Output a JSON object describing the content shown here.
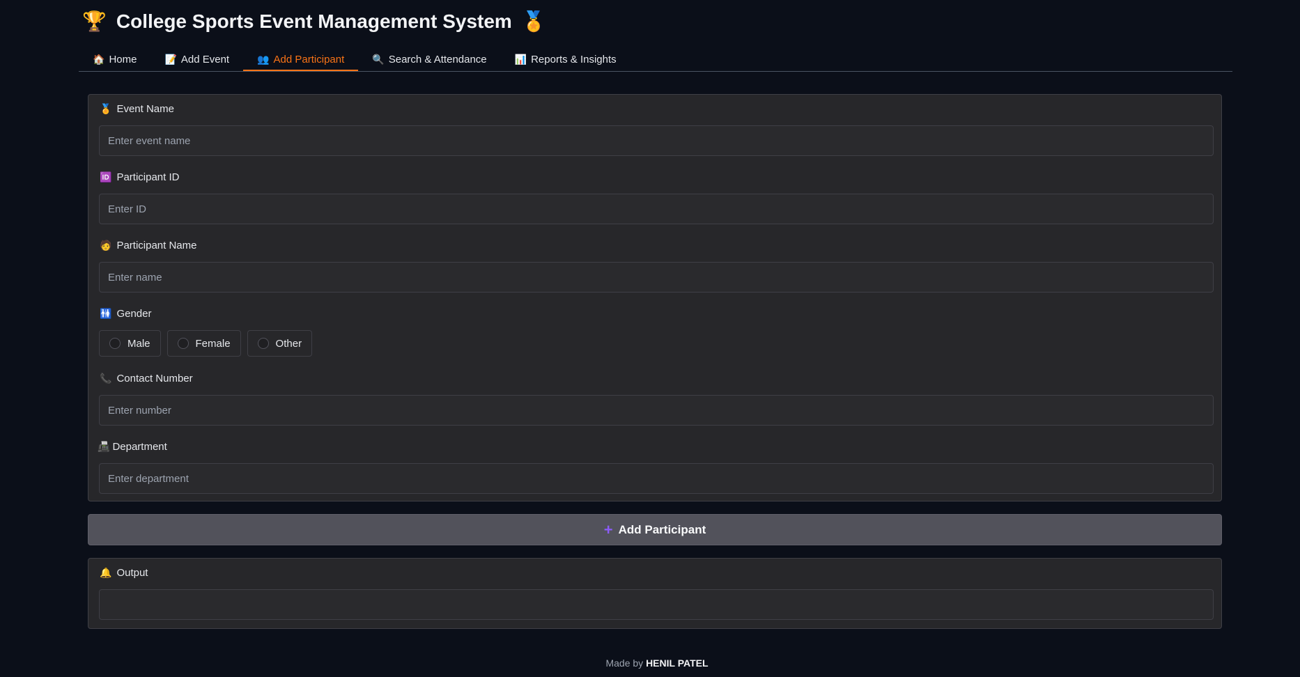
{
  "header": {
    "title": "College Sports Event Management System",
    "left_emoji": "🏆",
    "right_emoji": "🏅"
  },
  "tabs": [
    {
      "icon": "🏠",
      "label": "Home",
      "active": false
    },
    {
      "icon": "📝",
      "label": "Add Event",
      "active": false
    },
    {
      "icon": "👥",
      "label": "Add Participant",
      "active": true
    },
    {
      "icon": "🔍",
      "label": "Search & Attendance",
      "active": false
    },
    {
      "icon": "📊",
      "label": "Reports & Insights",
      "active": false
    }
  ],
  "form": {
    "event_name": {
      "icon": "🏅",
      "label": "Event Name",
      "placeholder": "Enter event name",
      "value": ""
    },
    "participant_id": {
      "icon": "🆔",
      "label": "Participant ID",
      "placeholder": "Enter ID",
      "value": ""
    },
    "participant_name": {
      "icon": "🧑",
      "label": "Participant Name",
      "placeholder": "Enter name",
      "value": ""
    },
    "gender": {
      "icon": "🚻",
      "label": "Gender",
      "options": [
        "Male",
        "Female",
        "Other"
      ],
      "selected": null
    },
    "contact": {
      "icon": "📞",
      "label": "Contact Number",
      "placeholder": "Enter number",
      "value": ""
    },
    "department": {
      "icon": "📠",
      "label": "Department",
      "placeholder": "Enter department",
      "value": ""
    }
  },
  "submit": {
    "icon": "➕",
    "label": "Add Participant"
  },
  "output": {
    "icon": "🔔",
    "label": "Output",
    "value": ""
  },
  "footer": {
    "prefix": "Made by",
    "author": "HENIL PATEL"
  },
  "colors": {
    "accent": "#f97316",
    "background": "#0b0f19",
    "panel": "#27272a",
    "button": "#52525b"
  }
}
